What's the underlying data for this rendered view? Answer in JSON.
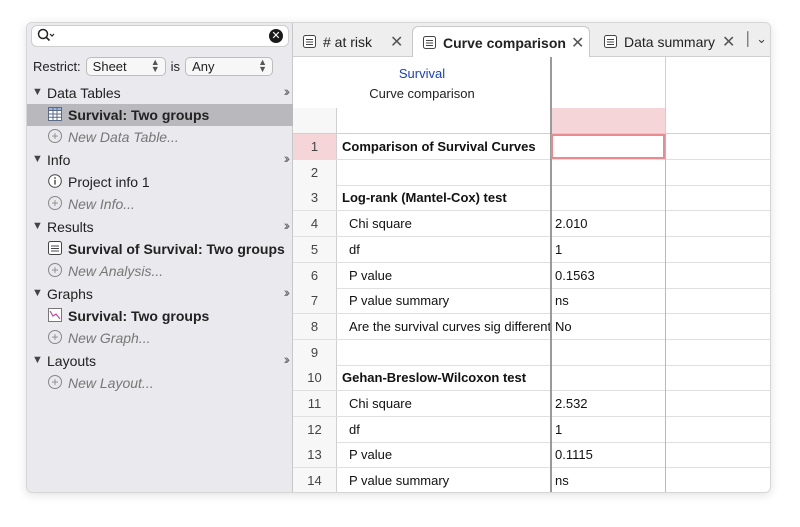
{
  "sidebar": {
    "search": {
      "value": "",
      "placeholder": ""
    },
    "restrict": {
      "label": "Restrict:",
      "field": "Sheet",
      "op": "is",
      "value": "Any"
    },
    "sections": [
      {
        "label": "Data Tables",
        "items": [
          {
            "label": "Survival: Two groups",
            "selected": true,
            "icon": "data-table-icon"
          },
          {
            "label": "New Data Table...",
            "new": true
          }
        ]
      },
      {
        "label": "Info",
        "items": [
          {
            "label": "Project info 1",
            "icon": "info-icon"
          },
          {
            "label": "New Info...",
            "new": true
          }
        ]
      },
      {
        "label": "Results",
        "items": [
          {
            "label": "Survival of Survival: Two groups",
            "icon": "results-icon"
          },
          {
            "label": "New Analysis...",
            "new": true
          }
        ]
      },
      {
        "label": "Graphs",
        "items": [
          {
            "label": "Survival: Two groups",
            "icon": "graph-icon"
          },
          {
            "label": "New Graph...",
            "new": true
          }
        ]
      },
      {
        "label": "Layouts",
        "items": [
          {
            "label": "New Layout...",
            "new": true
          }
        ]
      }
    ]
  },
  "tabs": [
    {
      "label": "# at risk",
      "active": false
    },
    {
      "label": "Curve comparison",
      "active": true
    },
    {
      "label": "Data summary",
      "active": false
    }
  ],
  "sheet": {
    "header_line1": "Survival",
    "header_line2": "Curve comparison",
    "rows": [
      {
        "n": "1",
        "label": "Comparison of Survival Curves",
        "value": "",
        "bold": true
      },
      {
        "n": "2",
        "label": "",
        "value": ""
      },
      {
        "n": "3",
        "label": "Log-rank (Mantel-Cox) test",
        "value": "",
        "bold": true
      },
      {
        "n": "4",
        "label": "Chi square",
        "value": "2.010",
        "indent": true
      },
      {
        "n": "5",
        "label": "df",
        "value": "1",
        "indent": true
      },
      {
        "n": "6",
        "label": "P value",
        "value": "0.1563",
        "indent": true
      },
      {
        "n": "7",
        "label": "P value summary",
        "value": "ns",
        "indent": true
      },
      {
        "n": "8",
        "label": "Are the survival curves sig different?",
        "value": "No",
        "indent": true
      },
      {
        "n": "9",
        "label": "",
        "value": ""
      },
      {
        "n": "10",
        "label": "Gehan-Breslow-Wilcoxon test",
        "value": "",
        "bold": true
      },
      {
        "n": "11",
        "label": "Chi square",
        "value": "2.532",
        "indent": true
      },
      {
        "n": "12",
        "label": "df",
        "value": "1",
        "indent": true
      },
      {
        "n": "13",
        "label": "P value",
        "value": "0.1115",
        "indent": true
      },
      {
        "n": "14",
        "label": "P value summary",
        "value": "ns",
        "indent": true
      }
    ]
  },
  "colors": {
    "selected_row": "#b8b8bd",
    "row_one_highlight": "#f5d5d7",
    "selection_border": "#e98a8f",
    "header_link": "#1a3fbf"
  }
}
